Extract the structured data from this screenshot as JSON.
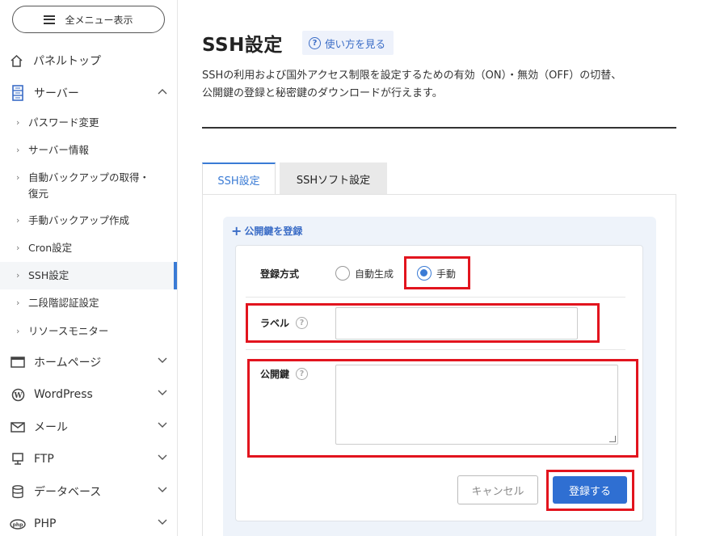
{
  "sidebar": {
    "menu_button": "全メニュー表示",
    "panel_top": "パネルトップ",
    "server": "サーバー",
    "server_items": [
      "パスワード変更",
      "サーバー情報",
      "自動バックアップの取得・",
      "復元",
      "手動バックアップ作成",
      "Cron設定",
      "SSH設定",
      "二段階認証設定",
      "リソースモニター"
    ],
    "sections": [
      "ホームページ",
      "WordPress",
      "メール",
      "FTP",
      "データベース",
      "PHP"
    ]
  },
  "main": {
    "title": "SSH設定",
    "help_label": "使い方を見る",
    "desc_line1": "SSHの利用および国外アクセス制限を設定するための有効（ON）・無効（OFF）の切替、",
    "desc_line2": "公開鍵の登録と秘密鍵のダウンロードが行えます。",
    "tabs": [
      "SSH設定",
      "SSHソフト設定"
    ]
  },
  "form": {
    "head": "公開鍵を登録",
    "method_label": "登録方式",
    "option_auto": "自動生成",
    "option_manual": "手動",
    "selected": "手動",
    "label_label": "ラベル",
    "label_value": "",
    "key_label": "公開鍵",
    "key_value": "",
    "cancel": "キャンセル",
    "submit": "登録する"
  },
  "colors": {
    "accent": "#3a7bd5",
    "submit": "#2f6fd2",
    "highlight": "#e2141e"
  }
}
